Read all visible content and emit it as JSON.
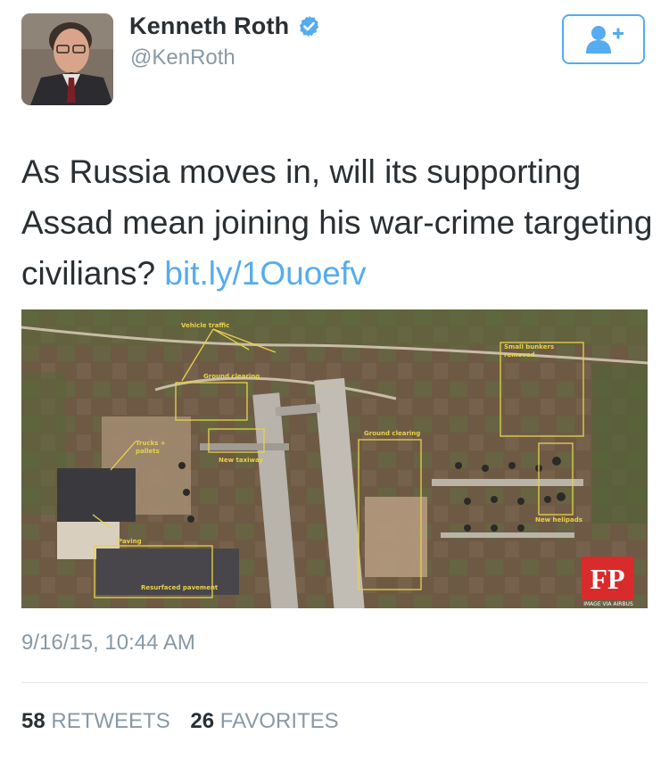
{
  "user": {
    "name": "Kenneth Roth",
    "handle": "@KenRoth",
    "verified": true,
    "avatar_icon": "profile-photo"
  },
  "follow_button": {
    "icon": "add-user-icon",
    "color": "#55acee"
  },
  "tweet": {
    "text": "As Russia moves in, will its supporting Assad mean joining his war-crime targeting civilians?",
    "link_text": "bit.ly/1Ouoefv",
    "link_color": "#55acee"
  },
  "media": {
    "description_type": "satellite-image",
    "annotations": {
      "vehicle_traffic": "Vehicle traffic",
      "ground_clearing_1": "Ground clearing",
      "trucks_pallets": "Trucks +\npallets",
      "new_taxiway": "New taxiway",
      "paving": "Paving",
      "resurfaced_pavement": "Resurfaced pavement",
      "ground_clearing_2": "Ground clearing",
      "small_bunkers_removed": "Small bunkers\nremoved",
      "new_helipads": "New helipads",
      "image_credit": "IMAGE VIA AIRBUS"
    },
    "logo_text": "FP",
    "annotation_color": "#e8d24a",
    "logo_color": "#d92b2b"
  },
  "timestamp": "9/16/15, 10:44 AM",
  "stats": {
    "retweets_count": "58",
    "retweets_label": "RETWEETS",
    "favorites_count": "26",
    "favorites_label": "FAVORITES"
  }
}
